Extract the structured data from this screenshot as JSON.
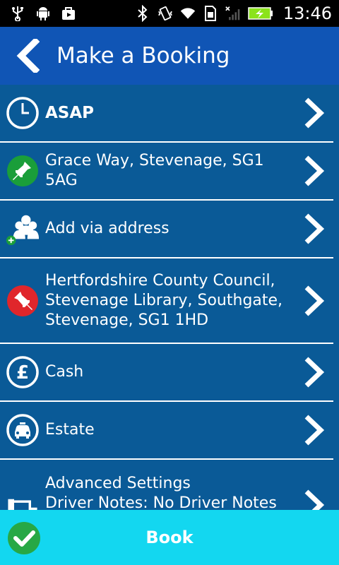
{
  "status_bar": {
    "time": "13:46"
  },
  "header": {
    "title": "Make a Booking"
  },
  "rows": [
    {
      "label": "ASAP",
      "icon": "clock-icon"
    },
    {
      "label": "Grace Way, Stevenage, SG1 5AG",
      "icon": "pickup-pin-icon"
    },
    {
      "label": "Add via address",
      "icon": "add-people-icon"
    },
    {
      "label_lines": [
        "Hertfordshire County Council,",
        "Stevenage Library, Southgate,",
        "Stevenage, SG1 1HD"
      ],
      "icon": "destination-pin-icon"
    },
    {
      "label": "Cash",
      "icon": "pound-icon"
    },
    {
      "label": "Estate",
      "icon": "car-icon"
    },
    {
      "label_lines": [
        "Advanced Settings",
        "Driver Notes: No Driver Notes"
      ],
      "icon": "settings-icon"
    }
  ],
  "book_button": {
    "label": "Book"
  },
  "colors": {
    "background": "#0a5a97",
    "header": "#1055b5",
    "book_bar": "#13d7f0",
    "pickup": "#1a9e3a",
    "destination": "#e0262b",
    "check": "#27a845"
  }
}
